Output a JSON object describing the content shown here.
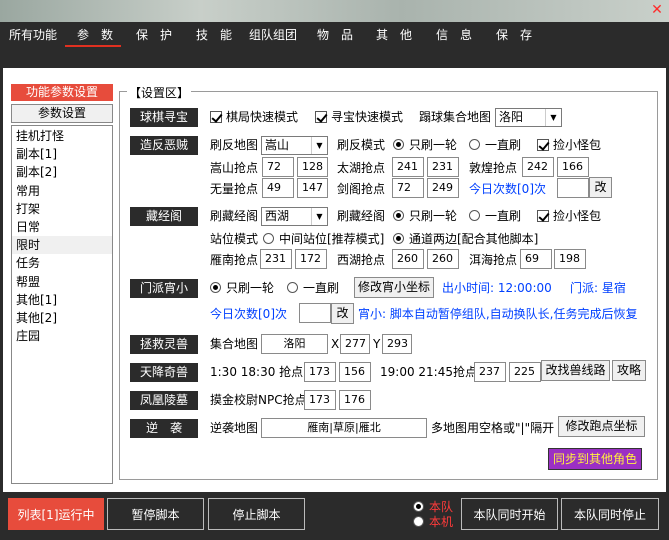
{
  "menu": [
    "所有功能",
    "参　数",
    "保　护",
    "技　能",
    "组队组团",
    "物　品",
    "其　他",
    "信　息",
    "保　存"
  ],
  "close_glyph": "✕",
  "left": {
    "header": "功能参数设置",
    "tab": "参数设置",
    "items": [
      "挂机打怪",
      "副本[1]",
      "副本[2]",
      "常用",
      "打架",
      "日常",
      "限时",
      "任务",
      "帮盟",
      "其他[1]",
      "其他[2]",
      "庄园"
    ],
    "selected": "限时"
  },
  "settings_title": "【设置区】",
  "qiuqi": {
    "label": "球棋寻宝",
    "chk1": "棋局快速模式",
    "chk2": "寻宝快速模式",
    "map_label": "蹋球集合地图",
    "map": "洛阳"
  },
  "zaofan": {
    "label": "造反恶贼",
    "map_label": "刷反地图",
    "map": "嵩山",
    "mode_label": "刷反模式",
    "r1": "只刷一轮",
    "r2": "一直刷",
    "chk": "捡小怪包",
    "p1": {
      "label": "嵩山抢点",
      "x": "72",
      "y": "128"
    },
    "p2": {
      "label": "太湖抢点",
      "x": "241",
      "y": "231"
    },
    "p3": {
      "label": "敦煌抢点",
      "x": "242",
      "y": "166"
    },
    "p4": {
      "label": "无量抢点",
      "x": "49",
      "y": "147"
    },
    "p5": {
      "label": "剑阁抢点",
      "x": "72",
      "y": "249"
    },
    "today": "今日次数[0]次",
    "btn": "改"
  },
  "cangjing": {
    "label": "藏经阁",
    "map_label": "刷藏经阁",
    "map": "西湖",
    "mode_label": "刷藏经阁",
    "r1": "只刷一轮",
    "r2": "一直刷",
    "chk": "捡小怪包",
    "station_label": "站位模式",
    "s1": "中间站位[推荐模式]",
    "s2": "通道两边[配合其他脚本]",
    "p1": {
      "label": "雁南抢点",
      "x": "231",
      "y": "172"
    },
    "p2": {
      "label": "西湖抢点",
      "x": "260",
      "y": "260"
    },
    "p3": {
      "label": "洱海抢点",
      "x": "69",
      "y": "198"
    }
  },
  "menpai": {
    "label": "门派宵小",
    "r1": "只刷一轮",
    "r2": "一直刷",
    "btn": "修改宵小坐标",
    "time": "出小时间: 12:00:00",
    "faction": "门派: 星宿",
    "today": "今日次数[0]次",
    "btn2": "改",
    "note": "宵小: 脚本自动暂停组队,自动换队长,任务完成后恢复"
  },
  "zhengjiu": {
    "label": "拯救灵兽",
    "map_label": "集合地图",
    "map": "洛阳",
    "x_label": "X",
    "x": "277",
    "y_label": "Y",
    "y": "293"
  },
  "tianjiang": {
    "label": "天降奇兽",
    "time1": "1:30 18:30 抢点",
    "x1": "173",
    "y1": "156",
    "time2": "19:00 21:45抢点",
    "x2": "237",
    "y2": "225",
    "btn1": "改找兽线路",
    "btn2": "攻略"
  },
  "fenghuang": {
    "label": "凤凰陵墓",
    "pt_label": "摸金校尉NPC抢点",
    "x": "173",
    "y": "176"
  },
  "nixi": {
    "label": "逆　袭",
    "map_label": "逆袭地图",
    "map": "雁南|草原|雁北",
    "hint": "多地图用空格或\"|\"隔开",
    "btn": "修改跑点坐标"
  },
  "sync": "同步到其他角色",
  "bottom": {
    "run": "列表[1]运行中",
    "pause": "暂停脚本",
    "stop": "停止脚本",
    "team": "本队",
    "self": "本机",
    "start": "本队同时开始",
    "stopall": "本队同时停止"
  },
  "colors": {
    "accent": "#e74c3c",
    "dark": "#2b2b2b",
    "blue": "#0040ff",
    "purple": "#9b2fc4"
  }
}
